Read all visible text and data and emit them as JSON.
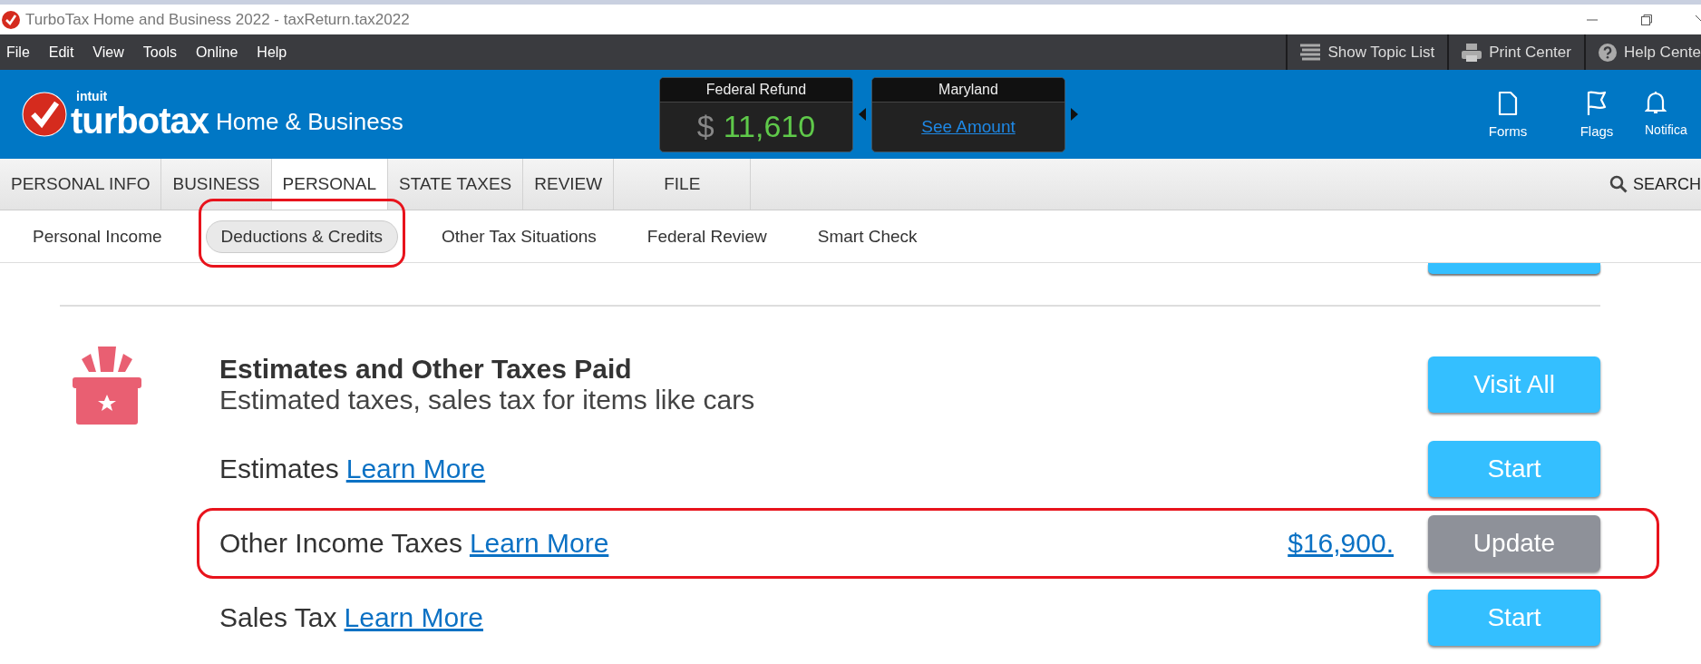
{
  "window": {
    "title": "TurboTax Home and Business 2022 - taxReturn.tax2022"
  },
  "menu": [
    "File",
    "Edit",
    "View",
    "Tools",
    "Online",
    "Help"
  ],
  "toolbar_buttons": [
    {
      "label": "Show Topic List",
      "kind": "list"
    },
    {
      "label": "Print Center",
      "kind": "print"
    },
    {
      "label": "Help Cente",
      "kind": "help"
    }
  ],
  "header": {
    "brand_small": "intuit",
    "brand": "turbotax",
    "edition": "Home & Business"
  },
  "refund_panels": [
    {
      "title": "Federal Refund",
      "kind": "amount",
      "currency": "$",
      "amount": "11,610"
    },
    {
      "title": "Maryland",
      "kind": "link",
      "link": "See Amount"
    }
  ],
  "header_icons": [
    {
      "label": "Forms",
      "kind": "forms"
    },
    {
      "label": "Flags",
      "kind": "flags"
    },
    {
      "label": "Notifica",
      "kind": "bell"
    }
  ],
  "tabs": [
    {
      "label": "PERSONAL INFO",
      "selected": false
    },
    {
      "label": "BUSINESS",
      "selected": false
    },
    {
      "label": "PERSONAL",
      "selected": true
    },
    {
      "label": "STATE TAXES",
      "selected": false
    },
    {
      "label": "REVIEW",
      "selected": false
    },
    {
      "label": "FILE",
      "selected": false
    }
  ],
  "search": "SEARCH",
  "subtabs": [
    {
      "label": "Personal Income",
      "selected": false,
      "highlighted": false
    },
    {
      "label": "Deductions & Credits",
      "selected": true,
      "highlighted": true
    },
    {
      "label": "Other Tax Situations",
      "selected": false,
      "highlighted": false
    },
    {
      "label": "Federal Review",
      "selected": false,
      "highlighted": false
    },
    {
      "label": "Smart Check",
      "selected": false,
      "highlighted": false
    }
  ],
  "section": {
    "title": "Estimates and Other Taxes Paid",
    "subtitle": "Estimated taxes, sales tax for items like cars",
    "button": "Visit All"
  },
  "rows": [
    {
      "label": "Estimates",
      "link": "Learn More",
      "button": "Start",
      "kind": "start",
      "highlighted": false
    },
    {
      "label": "Other Income Taxes",
      "link": "Learn More",
      "amount": "$16,900.",
      "button": "Update",
      "kind": "update",
      "highlighted": true
    },
    {
      "label": "Sales Tax",
      "link": "Learn More",
      "button": "Start",
      "kind": "start",
      "highlighted": false
    }
  ]
}
